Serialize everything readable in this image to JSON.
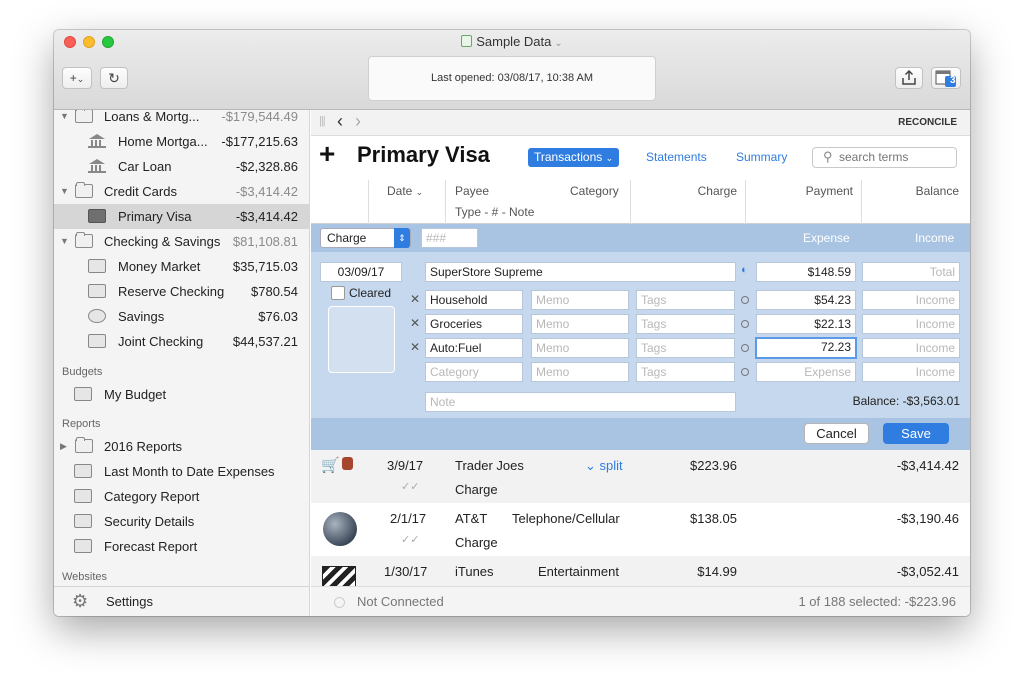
{
  "window": {
    "title": "Sample Data"
  },
  "toolbar": {
    "add_label": "+",
    "add_chevron": "⌄",
    "refresh_glyph": "↻",
    "last_opened": "Last opened:  03/08/17, 10:38 AM",
    "calendar_badge": "3"
  },
  "sidebar": {
    "accounts": [
      {
        "label": "Loans & Mortg...",
        "amount": "-$179,544.49",
        "group": true
      },
      {
        "label": "Home Mortga...",
        "amount": "-$177,215.63"
      },
      {
        "label": "Car Loan",
        "amount": "-$2,328.86"
      },
      {
        "label": "Credit Cards",
        "amount": "-$3,414.42",
        "group": true
      },
      {
        "label": "Primary Visa",
        "amount": "-$3,414.42",
        "selected": true
      },
      {
        "label": "Checking & Savings",
        "amount": "$81,108.81",
        "group": true
      },
      {
        "label": "Money Market",
        "amount": "$35,715.03"
      },
      {
        "label": "Reserve Checking",
        "amount": "$780.54"
      },
      {
        "label": "Savings",
        "amount": "$76.03"
      },
      {
        "label": "Joint Checking",
        "amount": "$44,537.21"
      }
    ],
    "budgets_header": "Budgets",
    "budget_item": "My Budget",
    "reports_header": "Reports",
    "reports": [
      "2016 Reports",
      "Last Month to Date Expenses",
      "Category Report",
      "Security Details",
      "Forecast Report"
    ],
    "websites_header": "Websites",
    "settings_label": "Settings"
  },
  "main": {
    "nav_back": "‹",
    "nav_forward": "›",
    "reconcile_label": "RECONCILE",
    "add_button": "+",
    "account_title": "Primary Visa",
    "tabs": {
      "transactions": "Transactions",
      "statements": "Statements",
      "summary": "Summary"
    },
    "search_placeholder": "search terms",
    "columns": {
      "date": "Date",
      "payee": "Payee",
      "category": "Category",
      "type_line": "Type  -  #  -  Note",
      "charge": "Charge",
      "payment": "Payment",
      "balance": "Balance"
    }
  },
  "editor": {
    "type_value": "Charge",
    "number_placeholder": "###",
    "expense_header": "Expense",
    "income_header": "Income",
    "date": "03/09/17",
    "payee": "SuperStore Supreme",
    "total_amount": "$148.59",
    "total_placeholder": "Total",
    "cleared_label": "Cleared",
    "splits": [
      {
        "category": "Household",
        "amount": "$54.23"
      },
      {
        "category": "Groceries",
        "amount": "$22.13"
      },
      {
        "category": "Auto:Fuel",
        "amount": "72.23"
      }
    ],
    "memo_placeholder": "Memo",
    "tags_placeholder": "Tags",
    "income_placeholder": "Income",
    "category_placeholder": "Category",
    "expense_placeholder": "Expense",
    "note_placeholder": "Note",
    "balance": "Balance:  -$3,563.01",
    "cancel_label": "Cancel",
    "save_label": "Save"
  },
  "transactions": [
    {
      "date": "3/9/17",
      "payee": "Trader Joes",
      "category": "⌄ split",
      "type": "Charge",
      "charge": "$223.96",
      "balance": "-$3,414.42"
    },
    {
      "date": "2/1/17",
      "payee": "AT&T",
      "category": "Telephone/Cellular",
      "type": "Charge",
      "charge": "$138.05",
      "balance": "-$3,190.46"
    },
    {
      "date": "1/30/17",
      "payee": "iTunes",
      "category": "Entertainment",
      "type": "",
      "charge": "$14.99",
      "balance": "-$3,052.41"
    }
  ],
  "status": {
    "connection": "Not Connected",
    "selection": "1 of 188 selected: -$223.96"
  },
  "colors": {
    "accent": "#2f7de1",
    "editor_bg": "#c6d8ed",
    "editor_bar": "#a9c4e2"
  }
}
